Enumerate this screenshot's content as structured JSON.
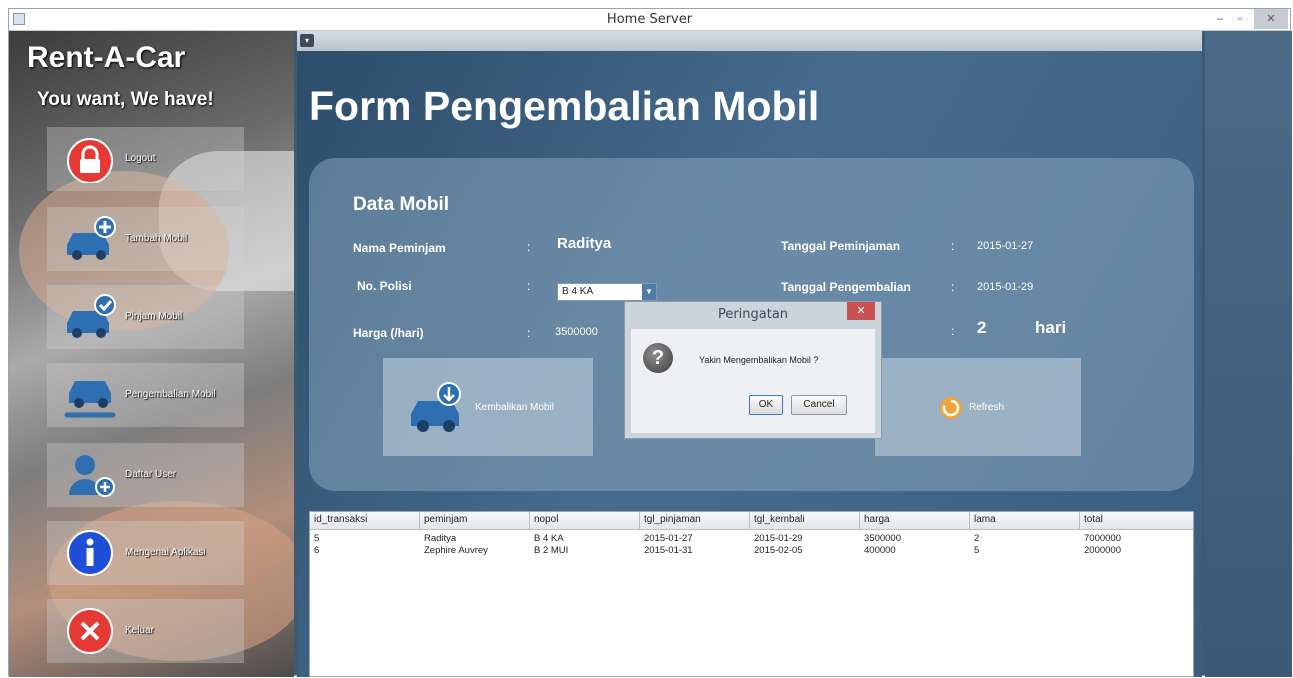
{
  "window": {
    "title": "Home Server",
    "min_label": "–",
    "max_label": "▫",
    "close_label": "✕"
  },
  "sidebar": {
    "brand": "Rent-A-Car",
    "slogan": "You want, We have!",
    "items": [
      {
        "label": "Logout",
        "icon": "lock-icon"
      },
      {
        "label": "Tambah Mobil",
        "icon": "car-add-icon"
      },
      {
        "label": "Pinjam Mobil",
        "icon": "car-check-icon"
      },
      {
        "label": "Pengembalian Mobil",
        "icon": "car-wrench-icon"
      },
      {
        "label": "Daftar User",
        "icon": "user-add-icon"
      },
      {
        "label": "Mengenai Aplikasi",
        "icon": "info-icon"
      },
      {
        "label": "Keluar",
        "icon": "close-icon"
      }
    ]
  },
  "form": {
    "title": "Form Pengembalian Mobil",
    "section_title": "Data Mobil",
    "nama_peminjam_label": "Nama Peminjam",
    "nama_peminjam_value": "Raditya",
    "no_polisi_label": "No. Polisi",
    "no_polisi_value": "B 4 KA",
    "harga_label": "Harga (/hari)",
    "harga_value": "3500000",
    "tgl_pinjam_label": "Tanggal Peminjaman",
    "tgl_pinjam_value": "2015-01-27",
    "tgl_kembali_label": "Tanggal Pengembalian",
    "tgl_kembali_value": "2015-01-29",
    "lama_value": "2",
    "lama_unit": "hari",
    "colon": ":",
    "kembalikan_label": "Kembalikan Mobil",
    "refresh_label": "Refresh"
  },
  "dialog": {
    "title": "Peringatan",
    "message": "Yakin Mengembalikan Mobil ?",
    "ok_label": "OK",
    "cancel_label": "Cancel",
    "close_label": "✕"
  },
  "table": {
    "columns": [
      "id_transaksi",
      "peminjam",
      "nopol",
      "tgl_pinjaman",
      "tgl_kembali",
      "harga",
      "lama",
      "total"
    ],
    "rows": [
      [
        "5",
        "Raditya",
        "B 4 KA",
        "2015-01-27",
        "2015-01-29",
        "3500000",
        "2",
        "7000000"
      ],
      [
        "6",
        "Zephire Auvrey",
        "B 2 MUI",
        "2015-01-31",
        "2015-02-05",
        "400000",
        "5",
        "2000000"
      ]
    ]
  },
  "colors": {
    "accent": "#4f7ca6",
    "dialog_close": "#c9514f",
    "lock_red": "#e53935",
    "info_blue": "#1e4fd6"
  }
}
